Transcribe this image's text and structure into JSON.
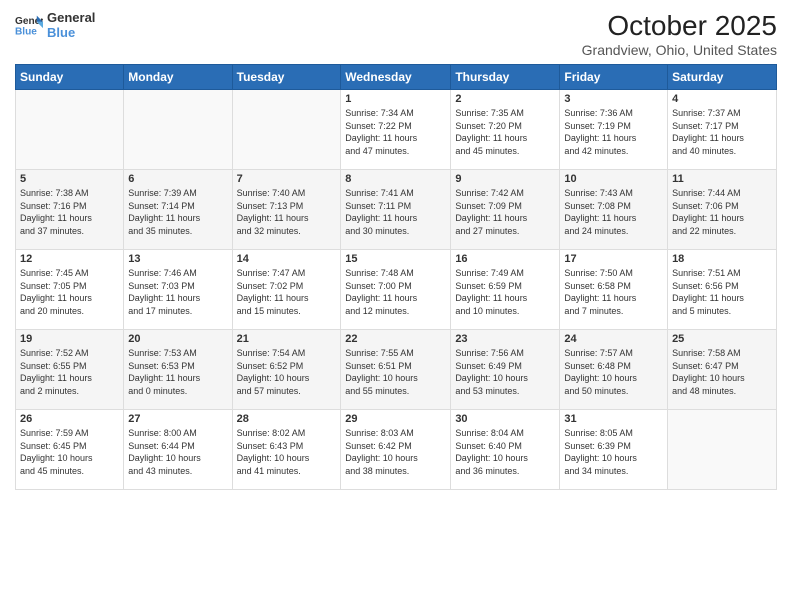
{
  "logo": {
    "line1": "General",
    "line2": "Blue"
  },
  "title": "October 2025",
  "location": "Grandview, Ohio, United States",
  "days_header": [
    "Sunday",
    "Monday",
    "Tuesday",
    "Wednesday",
    "Thursday",
    "Friday",
    "Saturday"
  ],
  "weeks": [
    [
      {
        "num": "",
        "info": ""
      },
      {
        "num": "",
        "info": ""
      },
      {
        "num": "",
        "info": ""
      },
      {
        "num": "1",
        "info": "Sunrise: 7:34 AM\nSunset: 7:22 PM\nDaylight: 11 hours\nand 47 minutes."
      },
      {
        "num": "2",
        "info": "Sunrise: 7:35 AM\nSunset: 7:20 PM\nDaylight: 11 hours\nand 45 minutes."
      },
      {
        "num": "3",
        "info": "Sunrise: 7:36 AM\nSunset: 7:19 PM\nDaylight: 11 hours\nand 42 minutes."
      },
      {
        "num": "4",
        "info": "Sunrise: 7:37 AM\nSunset: 7:17 PM\nDaylight: 11 hours\nand 40 minutes."
      }
    ],
    [
      {
        "num": "5",
        "info": "Sunrise: 7:38 AM\nSunset: 7:16 PM\nDaylight: 11 hours\nand 37 minutes."
      },
      {
        "num": "6",
        "info": "Sunrise: 7:39 AM\nSunset: 7:14 PM\nDaylight: 11 hours\nand 35 minutes."
      },
      {
        "num": "7",
        "info": "Sunrise: 7:40 AM\nSunset: 7:13 PM\nDaylight: 11 hours\nand 32 minutes."
      },
      {
        "num": "8",
        "info": "Sunrise: 7:41 AM\nSunset: 7:11 PM\nDaylight: 11 hours\nand 30 minutes."
      },
      {
        "num": "9",
        "info": "Sunrise: 7:42 AM\nSunset: 7:09 PM\nDaylight: 11 hours\nand 27 minutes."
      },
      {
        "num": "10",
        "info": "Sunrise: 7:43 AM\nSunset: 7:08 PM\nDaylight: 11 hours\nand 24 minutes."
      },
      {
        "num": "11",
        "info": "Sunrise: 7:44 AM\nSunset: 7:06 PM\nDaylight: 11 hours\nand 22 minutes."
      }
    ],
    [
      {
        "num": "12",
        "info": "Sunrise: 7:45 AM\nSunset: 7:05 PM\nDaylight: 11 hours\nand 20 minutes."
      },
      {
        "num": "13",
        "info": "Sunrise: 7:46 AM\nSunset: 7:03 PM\nDaylight: 11 hours\nand 17 minutes."
      },
      {
        "num": "14",
        "info": "Sunrise: 7:47 AM\nSunset: 7:02 PM\nDaylight: 11 hours\nand 15 minutes."
      },
      {
        "num": "15",
        "info": "Sunrise: 7:48 AM\nSunset: 7:00 PM\nDaylight: 11 hours\nand 12 minutes."
      },
      {
        "num": "16",
        "info": "Sunrise: 7:49 AM\nSunset: 6:59 PM\nDaylight: 11 hours\nand 10 minutes."
      },
      {
        "num": "17",
        "info": "Sunrise: 7:50 AM\nSunset: 6:58 PM\nDaylight: 11 hours\nand 7 minutes."
      },
      {
        "num": "18",
        "info": "Sunrise: 7:51 AM\nSunset: 6:56 PM\nDaylight: 11 hours\nand 5 minutes."
      }
    ],
    [
      {
        "num": "19",
        "info": "Sunrise: 7:52 AM\nSunset: 6:55 PM\nDaylight: 11 hours\nand 2 minutes."
      },
      {
        "num": "20",
        "info": "Sunrise: 7:53 AM\nSunset: 6:53 PM\nDaylight: 11 hours\nand 0 minutes."
      },
      {
        "num": "21",
        "info": "Sunrise: 7:54 AM\nSunset: 6:52 PM\nDaylight: 10 hours\nand 57 minutes."
      },
      {
        "num": "22",
        "info": "Sunrise: 7:55 AM\nSunset: 6:51 PM\nDaylight: 10 hours\nand 55 minutes."
      },
      {
        "num": "23",
        "info": "Sunrise: 7:56 AM\nSunset: 6:49 PM\nDaylight: 10 hours\nand 53 minutes."
      },
      {
        "num": "24",
        "info": "Sunrise: 7:57 AM\nSunset: 6:48 PM\nDaylight: 10 hours\nand 50 minutes."
      },
      {
        "num": "25",
        "info": "Sunrise: 7:58 AM\nSunset: 6:47 PM\nDaylight: 10 hours\nand 48 minutes."
      }
    ],
    [
      {
        "num": "26",
        "info": "Sunrise: 7:59 AM\nSunset: 6:45 PM\nDaylight: 10 hours\nand 45 minutes."
      },
      {
        "num": "27",
        "info": "Sunrise: 8:00 AM\nSunset: 6:44 PM\nDaylight: 10 hours\nand 43 minutes."
      },
      {
        "num": "28",
        "info": "Sunrise: 8:02 AM\nSunset: 6:43 PM\nDaylight: 10 hours\nand 41 minutes."
      },
      {
        "num": "29",
        "info": "Sunrise: 8:03 AM\nSunset: 6:42 PM\nDaylight: 10 hours\nand 38 minutes."
      },
      {
        "num": "30",
        "info": "Sunrise: 8:04 AM\nSunset: 6:40 PM\nDaylight: 10 hours\nand 36 minutes."
      },
      {
        "num": "31",
        "info": "Sunrise: 8:05 AM\nSunset: 6:39 PM\nDaylight: 10 hours\nand 34 minutes."
      },
      {
        "num": "",
        "info": ""
      }
    ]
  ]
}
